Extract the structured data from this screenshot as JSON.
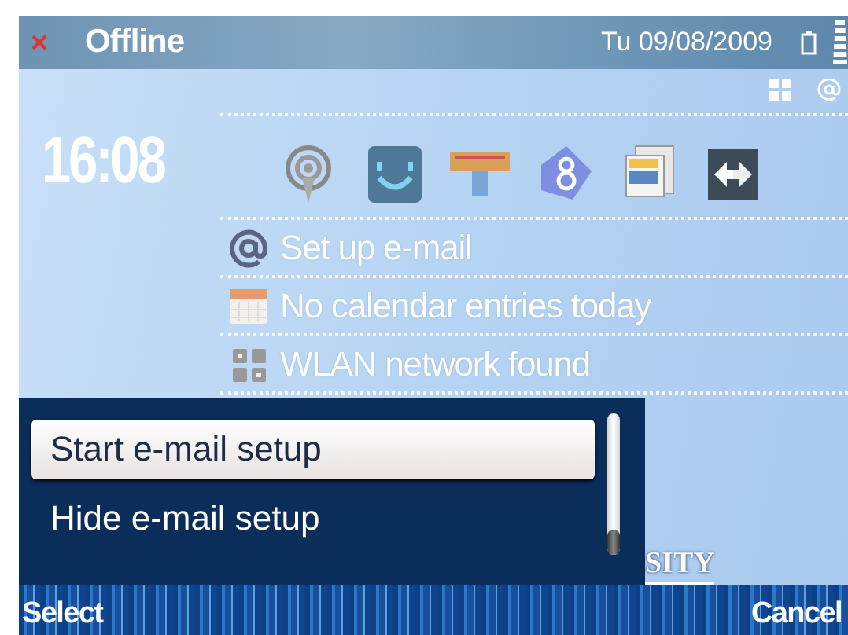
{
  "status_bar": {
    "profile": "Offline",
    "date": "Tu 09/08/2009"
  },
  "clock": "16:08",
  "notifications": [
    {
      "kind": "email",
      "text": "Set up e-mail"
    },
    {
      "kind": "calendar",
      "text": "No calendar entries today"
    },
    {
      "kind": "wlan",
      "text": "WLAN network found"
    }
  ],
  "background_text": "SITY",
  "menu": {
    "items": [
      {
        "label": "Start e-mail setup",
        "selected": true
      },
      {
        "label": "Hide e-mail setup",
        "selected": false
      }
    ],
    "level": 1
  },
  "softkeys": {
    "left": "Select",
    "right": "Cancel"
  }
}
